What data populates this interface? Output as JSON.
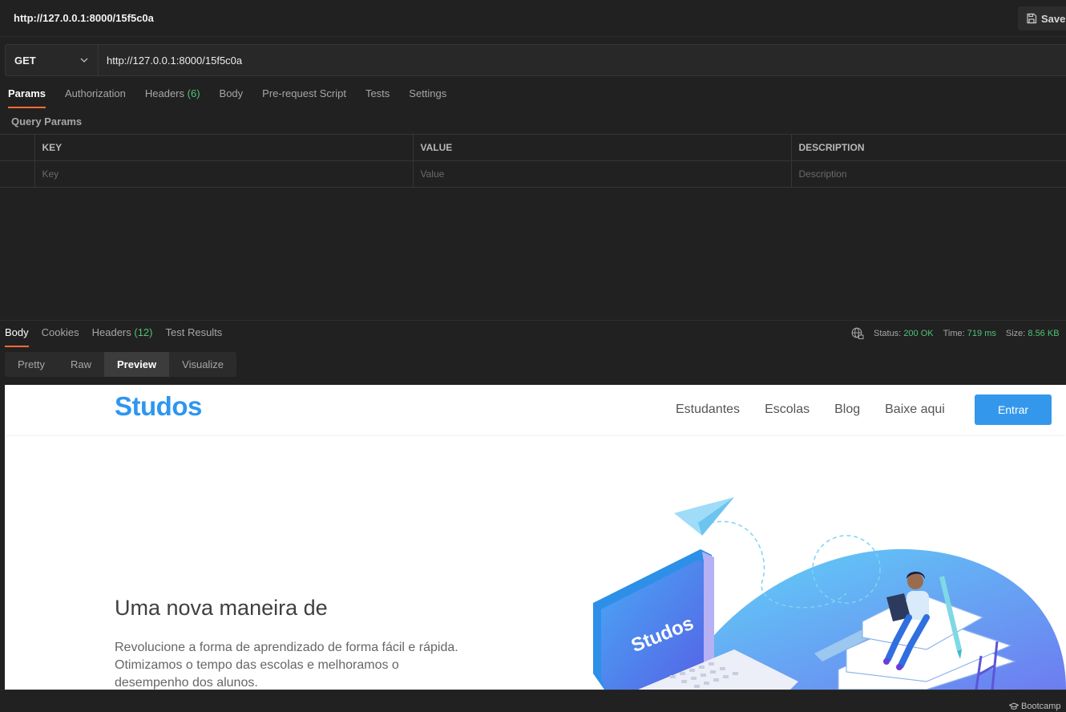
{
  "request": {
    "title": "http://127.0.0.1:8000/15f5c0a",
    "save_label": "Save",
    "method": "GET",
    "url": "http://127.0.0.1:8000/15f5c0a",
    "tabs": [
      {
        "label": "Params"
      },
      {
        "label": "Authorization"
      },
      {
        "label": "Headers",
        "count": "(6)"
      },
      {
        "label": "Body"
      },
      {
        "label": "Pre-request Script"
      },
      {
        "label": "Tests"
      },
      {
        "label": "Settings"
      }
    ],
    "query_params_title": "Query Params",
    "columns": [
      "KEY",
      "VALUE",
      "DESCRIPTION"
    ],
    "placeholders": [
      "Key",
      "Value",
      "Description"
    ]
  },
  "response": {
    "tabs": [
      {
        "label": "Body"
      },
      {
        "label": "Cookies"
      },
      {
        "label": "Headers",
        "count": "(12)"
      },
      {
        "label": "Test Results"
      }
    ],
    "status_label": "Status:",
    "status_value": "200 OK",
    "time_label": "Time:",
    "time_value": "719 ms",
    "size_label": "Size:",
    "size_value": "8.56 KB",
    "view_modes": [
      "Pretty",
      "Raw",
      "Preview",
      "Visualize"
    ]
  },
  "preview": {
    "logo": "Studos",
    "nav_links": [
      "Estudantes",
      "Escolas",
      "Blog",
      "Baixe aqui"
    ],
    "login_button": "Entrar",
    "hero_title": "Uma nova maneira de",
    "hero_text": "Revolucione a forma de aprendizado de forma fácil e rápida. Otimizamos o tempo das escolas e melhoramos o desempenho dos alunos.",
    "laptop_logo": "Studos"
  },
  "footer": {
    "bootcamp_label": "Bootcamp"
  },
  "colors": {
    "accent": "#ff6c37",
    "status_green": "#4ec376",
    "brand_blue": "#2d96f0"
  }
}
